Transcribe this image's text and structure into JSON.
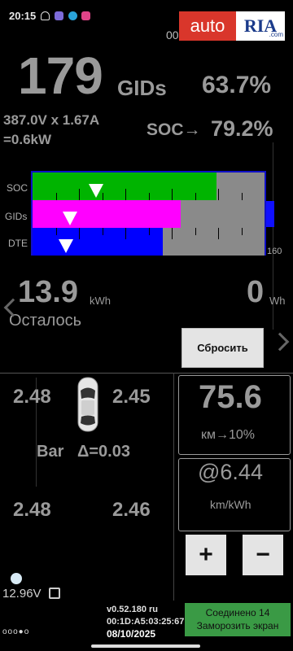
{
  "status_bar": {
    "time": "20:15",
    "clock": "00:08:12"
  },
  "watermark": {
    "left": "auto",
    "right": "RIA",
    "suffix": ".com"
  },
  "battery": {
    "gids": "179",
    "gids_unit": "GIDs",
    "gids_percent": "63.7%",
    "voltage_current": "387.0V x 1.67A",
    "power": "=0.6kW",
    "soc_label": "SOC→",
    "soc_percent": "79.2%"
  },
  "graph": {
    "rows": [
      {
        "label": "SOC",
        "fill_fraction": 0.792,
        "color": "#00b400"
      },
      {
        "label": "GIDs",
        "fill_fraction": 0.637,
        "color": "#ff00ff"
      },
      {
        "label": "DTE",
        "fill_fraction": 0.56,
        "color": "#0000ff"
      }
    ],
    "scale_end": "160",
    "colors": {
      "frame": "#1010c8",
      "empty": "#8a8a8a"
    }
  },
  "energy": {
    "remaining_value": "13.9",
    "remaining_unit": "kWh",
    "used_value": "0",
    "used_unit": "Wh",
    "remaining_label": "Осталось",
    "reset_label": "Сбросить"
  },
  "tires": {
    "front_left": "2.48",
    "front_right": "2.45",
    "rear_left": "2.48",
    "rear_right": "2.46",
    "unit": "Bar",
    "delta": "Δ=0.03"
  },
  "range": {
    "value": "75.6",
    "unit": "км→10%"
  },
  "efficiency": {
    "value": "@6.44",
    "unit": "km/kWh"
  },
  "controls": {
    "plus": "+",
    "minus": "−"
  },
  "footer": {
    "battery_12v": "12.96V",
    "version": "v0.52.180 ru",
    "mac": "00:1D:A5:03:25:67",
    "date": "08/10/2025",
    "connection": "Соединено 14",
    "freeze": "Заморозить экран",
    "dots": "ooo●o"
  }
}
